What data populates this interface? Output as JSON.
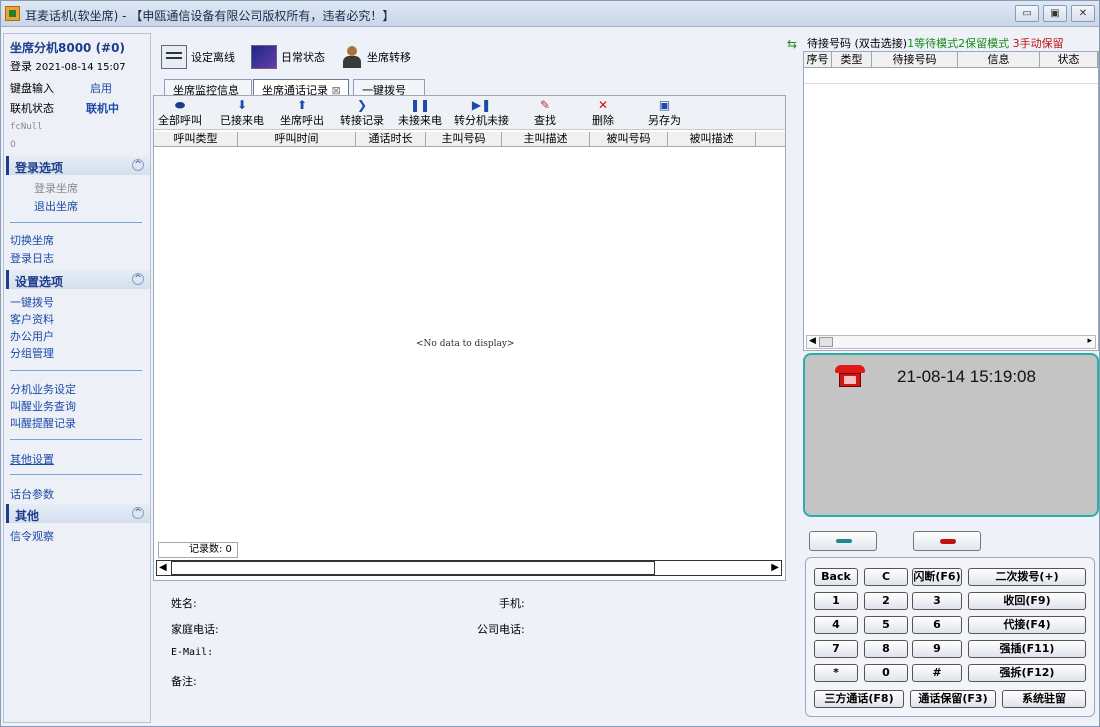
{
  "window": {
    "title": "耳麦话机(软坐席) - 【申瓯通信设备有限公司版权所有，违者必究！】"
  },
  "left": {
    "agent": "坐席分机8000 (#0)",
    "login_label": "登录",
    "login_time": "2021-08-14 15:07",
    "keyboard_label": "键盘输入",
    "keyboard_value": "启用",
    "link_label": "联机状态",
    "link_value": "联机中",
    "fc_null": "fcNull",
    "zero": "0",
    "sections": {
      "login": "登录选项",
      "settings": "设置选项",
      "other": "其他"
    },
    "login_items": [
      "登录坐席",
      "退出坐席"
    ],
    "items_a": [
      "切换坐席",
      "登录日志"
    ],
    "settings_items": [
      "一键拨号",
      "客户资料",
      "办公用户",
      "分组管理"
    ],
    "items_b": [
      "分机业务设定",
      "叫醒业务查询",
      "叫醒提醒记录"
    ],
    "other_settings": "其他设置",
    "talk_params": "话台参数",
    "other_items": [
      "信令观察"
    ],
    "collapse": "^"
  },
  "toolbar": {
    "offline": "设定离线",
    "daily": "日常状态",
    "transfer": "坐席转移"
  },
  "tabs": [
    "坐席监控信息",
    "坐席通话记录",
    "一键拨号"
  ],
  "tab_close": "⊠",
  "actions": [
    "全部呼叫",
    "已接来电",
    "坐席呼出",
    "转接记录",
    "未接来电",
    "转分机未接",
    "查找",
    "删除",
    "另存为"
  ],
  "grid_columns": [
    "呼叫类型",
    "呼叫时间",
    "通话时长",
    "主叫号码",
    "主叫描述",
    "被叫号码",
    "被叫描述"
  ],
  "no_data": "<No data to display>",
  "record_count": "记录数: 0",
  "info": {
    "name": "姓名:",
    "mobile": "手机:",
    "home": "家庭电话:",
    "company": "公司电话:",
    "email": "E-Mail:",
    "note": "备注:"
  },
  "queue": {
    "title": "待接号码 (双击选接)",
    "mode1": "1等待模式",
    "mode2": "2保留模式",
    "mode3": "3手动保留",
    "columns": [
      "序号",
      "类型",
      "待接号码",
      "信息",
      "状态"
    ]
  },
  "phone": {
    "datetime": "21-08-14 15:19:08"
  },
  "keys": {
    "row1": [
      "Back",
      "C",
      "闪断(F6)",
      "二次拨号(+)"
    ],
    "row2": [
      "1",
      "2",
      "3",
      "收回(F9)"
    ],
    "row3": [
      "4",
      "5",
      "6",
      "代接(F4)"
    ],
    "row4": [
      "7",
      "8",
      "9",
      "强插(F11)"
    ],
    "row5": [
      "*",
      "0",
      "#",
      "强拆(F12)"
    ],
    "row6": [
      "三方通话(F8)",
      "通话保留(F3)",
      "系统驻留"
    ]
  },
  "colors": {
    "accent_blue": "#1d3c8c",
    "link_blue": "#1d49a8",
    "phone_border": "#27b0a8",
    "mode_green": "#1a8a1a",
    "mode_red": "#c01010"
  }
}
